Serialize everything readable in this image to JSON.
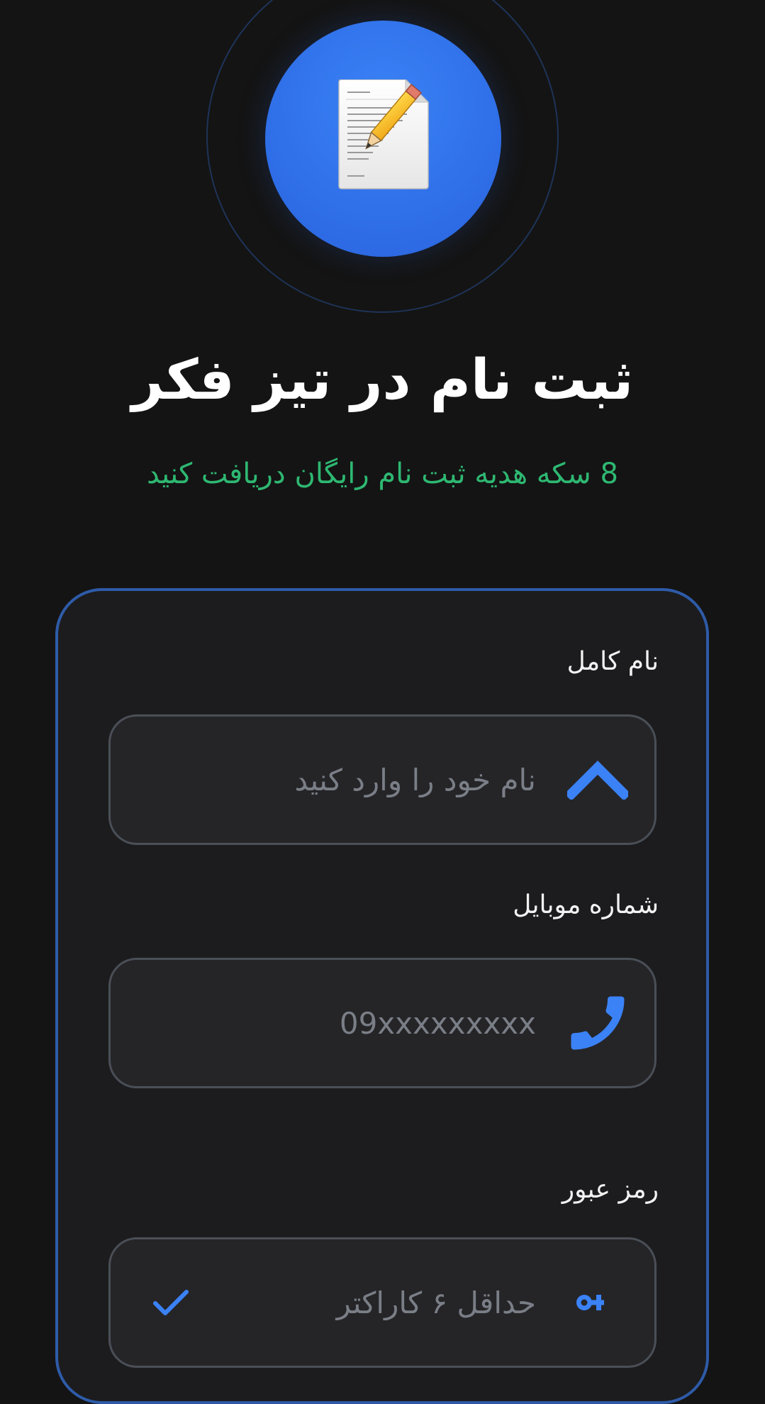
{
  "header": {
    "title": "ثبت نام در تیز فکر",
    "subtitle": "8 سکه هدیه ثبت نام رایگان دریافت کنید",
    "logo_icon": "document-edit-icon"
  },
  "form": {
    "name": {
      "label": "نام کامل",
      "placeholder": "نام خود را وارد کنید",
      "value": "",
      "icon": "chevron-up-icon"
    },
    "mobile": {
      "label": "شماره موبایل",
      "placeholder": "09xxxxxxxxx",
      "value": "",
      "icon": "phone-icon"
    },
    "password": {
      "label": "رمز عبور",
      "placeholder": "حداقل ۶ کاراکتر",
      "value": "",
      "icon": "key-icon",
      "toggle_icon": "check-icon"
    }
  },
  "colors": {
    "background": "#141414",
    "accent": "#3b82f6",
    "subtitle": "#2eb872",
    "card_border": "#2e5ba8"
  }
}
